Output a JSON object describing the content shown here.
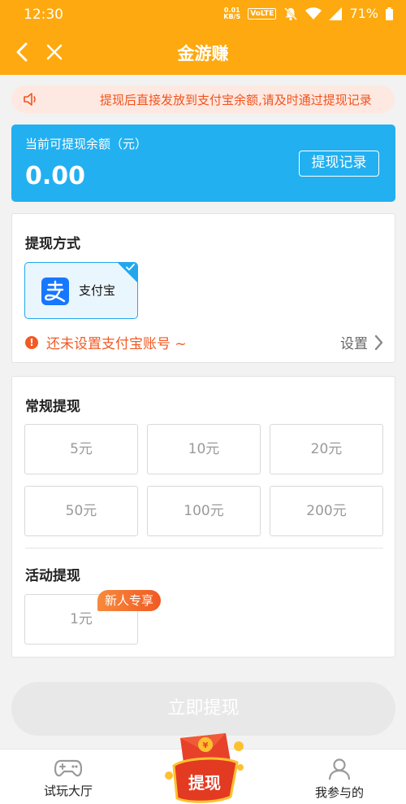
{
  "status": {
    "time": "12:30",
    "net_top": "0.01",
    "net_bottom": "KB/S",
    "volte": "VoLTE",
    "battery": "71%"
  },
  "nav": {
    "title": "金游赚"
  },
  "notice": {
    "text": "提现后直接发放到支付宝余额,请及时通过提现记录"
  },
  "balance": {
    "label": "当前可提现余额（元）",
    "amount": "0.00",
    "records_label": "提现记录",
    "color": "#22b0f1"
  },
  "method": {
    "title": "提现方式",
    "alipay_label": "支付宝",
    "warning": "还未设置支付宝账号 ~",
    "setup_label": "设置"
  },
  "regular": {
    "title": "常规提现",
    "amounts": [
      "5元",
      "10元",
      "20元",
      "50元",
      "100元",
      "200元"
    ]
  },
  "activity": {
    "title": "活动提现",
    "amount": "1元",
    "badge": "新人专享"
  },
  "withdraw_button": "立即提现",
  "tabbar": {
    "left": "试玩大厅",
    "center": "提现",
    "right": "我参与的"
  },
  "colors": {
    "accent": "#fda90f",
    "warning": "#f15a24"
  }
}
